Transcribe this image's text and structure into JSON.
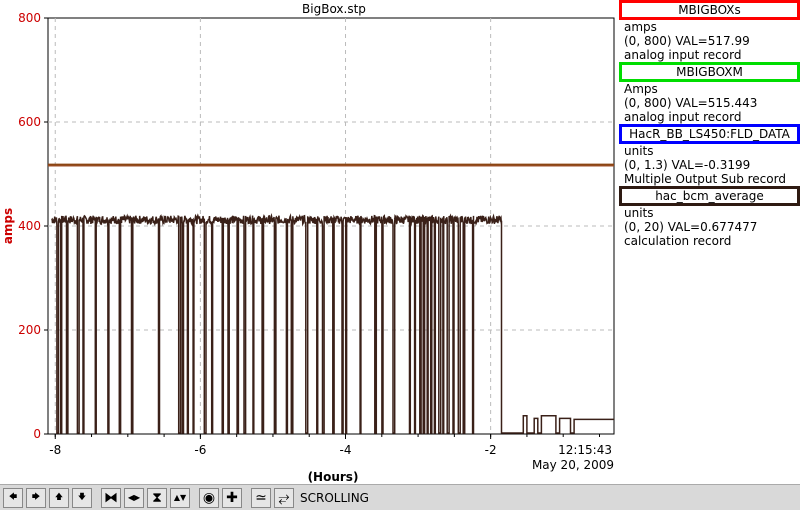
{
  "window": {
    "title": "BigBox.stp"
  },
  "chart_data": {
    "type": "line",
    "title": "BigBox.stp",
    "ylabel": "amps",
    "xlabel": "(Hours)",
    "ylim": [
      0,
      800
    ],
    "xlim": [
      -8.1,
      -0.3
    ],
    "y_ticks": [
      "0",
      "200",
      "400",
      "600",
      "800"
    ],
    "x_ticks": [
      "-8",
      "-6",
      "-4",
      "-2"
    ],
    "grid": true,
    "timestamp": {
      "time": "12:15:43",
      "date": "May 20, 2009"
    },
    "series": [
      {
        "name": "MBIGBOXs",
        "color": "#ff0000",
        "x": [
          -8.1,
          -0.3
        ],
        "values": [
          517.99,
          517.99
        ]
      },
      {
        "name": "MBIGBOXM",
        "color": "#00cc00",
        "x": [
          -8.1,
          -0.3
        ],
        "values": [
          515.44,
          515.44
        ]
      },
      {
        "name": "hac_bcm_average",
        "color": "#3a2018",
        "x": [
          -8.1,
          -1.85,
          -1.85,
          -0.3
        ],
        "values": [
          412,
          412,
          3,
          28
        ]
      }
    ]
  },
  "legend": [
    {
      "title": "MBIGBOXs",
      "color": "#ff0000",
      "unit": "amps",
      "range_val": "(0, 800)  VAL=517.99",
      "rtype": "analog input record"
    },
    {
      "title": "MBIGBOXM",
      "color": "#00dd00",
      "unit": "Amps",
      "range_val": "(0, 800) VAL=515.443",
      "rtype": "analog input record"
    },
    {
      "title": "HacR_BB_LS450:FLD_DATA",
      "color": "#0000ff",
      "unit": "units",
      "range_val": "(0, 1.3) VAL=-0.3199",
      "rtype": "Multiple Output Sub record"
    },
    {
      "title": "hac_bcm_average",
      "color": "#2e1a12",
      "unit": "units",
      "range_val": "(0, 20) VAL=0.677477",
      "rtype": "calculation record"
    }
  ],
  "toolbar": {
    "buttons": [
      {
        "name": "scroll-left-button",
        "glyph": "🡄"
      },
      {
        "name": "scroll-right-button",
        "glyph": "🡆"
      },
      {
        "name": "scroll-up-button",
        "glyph": "🡅"
      },
      {
        "name": "scroll-down-button",
        "glyph": "🡇"
      },
      {
        "name": "compress-x-button",
        "glyph": "⧓"
      },
      {
        "name": "expand-x-button",
        "glyph": "◀▶"
      },
      {
        "name": "compress-y-button",
        "glyph": "⧗"
      },
      {
        "name": "expand-y-button",
        "glyph": "▲▼"
      },
      {
        "name": "zoom-button",
        "glyph": "◉"
      },
      {
        "name": "add-button",
        "glyph": "✚"
      },
      {
        "name": "autoscale-button",
        "glyph": "≃"
      },
      {
        "name": "toggle-scale-button",
        "glyph": "⥂"
      }
    ],
    "mode_label": "SCROLLING"
  }
}
